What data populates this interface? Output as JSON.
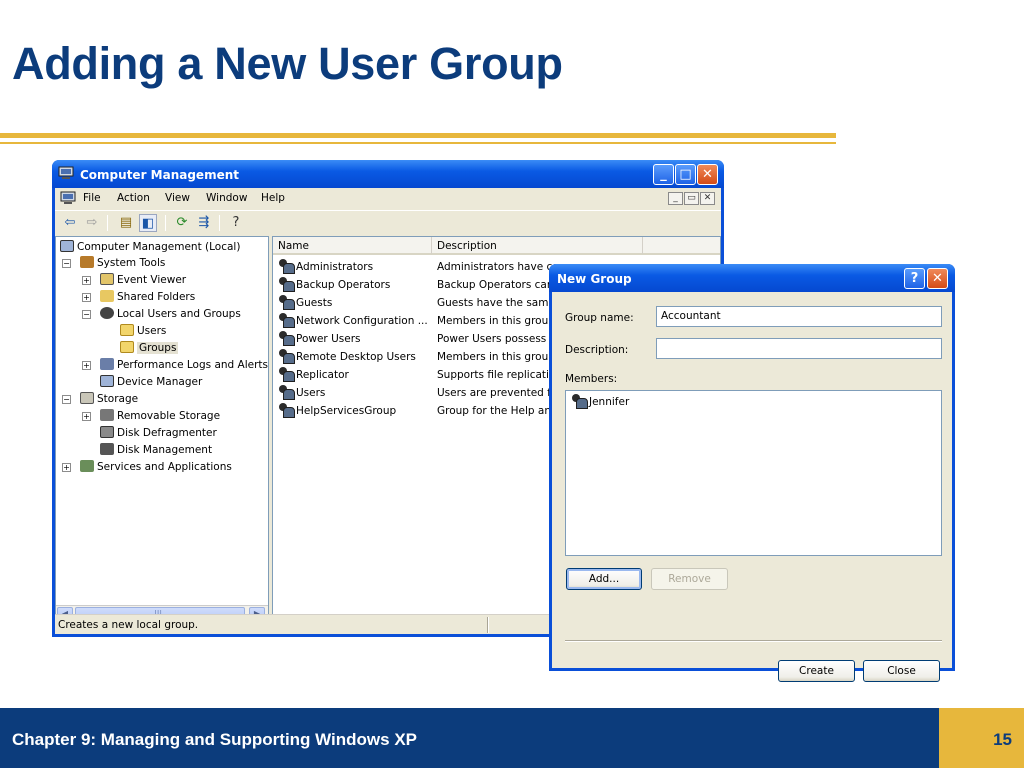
{
  "slide": {
    "title": "Adding a New User Group",
    "footer_text": "Chapter 9: Managing and Supporting Windows XP",
    "page_number": "15",
    "colors": {
      "title": "#0c3c7c",
      "accent_gold": "#e7b73c",
      "footer_bg": "#0c3c7c"
    }
  },
  "computer_management": {
    "title": "Computer Management",
    "menu": [
      "File",
      "Action",
      "View",
      "Window",
      "Help"
    ],
    "caption_buttons": {
      "minimize": "_",
      "maximize": "□",
      "close": "✕"
    },
    "mdi_buttons": [
      "_",
      "▭",
      "✕"
    ],
    "toolbar": {
      "back": "⇦",
      "forward": "⇨",
      "up": "▤",
      "show_hide": "◧",
      "refresh": "⟳",
      "export": "⇶",
      "help": "?"
    },
    "tree": [
      {
        "label": "Computer Management (Local)",
        "icon": "computer-icon"
      },
      {
        "label": "System Tools",
        "icon": "tools-icon"
      },
      {
        "label": "Event Viewer",
        "icon": "event-viewer-icon"
      },
      {
        "label": "Shared Folders",
        "icon": "shared-folder-icon"
      },
      {
        "label": "Local Users and Groups",
        "icon": "users-groups-icon"
      },
      {
        "label": "Users",
        "icon": "folder-icon"
      },
      {
        "label": "Groups",
        "icon": "folder-open-icon"
      },
      {
        "label": "Performance Logs and Alerts",
        "icon": "performance-icon"
      },
      {
        "label": "Device Manager",
        "icon": "device-manager-icon"
      },
      {
        "label": "Storage",
        "icon": "storage-icon"
      },
      {
        "label": "Removable Storage",
        "icon": "removable-storage-icon"
      },
      {
        "label": "Disk Defragmenter",
        "icon": "defrag-icon"
      },
      {
        "label": "Disk Management",
        "icon": "disk-management-icon"
      },
      {
        "label": "Services and Applications",
        "icon": "services-icon"
      }
    ],
    "tree_expanders": {
      "minus": "−",
      "plus": "+"
    },
    "scroll": {
      "left": "◀",
      "right": "▶",
      "grip": "|||"
    },
    "columns": [
      "Name",
      "Description"
    ],
    "groups": [
      {
        "name": "Administrators",
        "description": "Administrators have co"
      },
      {
        "name": "Backup Operators",
        "description": "Backup Operators can"
      },
      {
        "name": "Guests",
        "description": "Guests have the same"
      },
      {
        "name": "Network Configuration ...",
        "description": "Members in this group"
      },
      {
        "name": "Power Users",
        "description": "Power Users possess m"
      },
      {
        "name": "Remote Desktop Users",
        "description": "Members in this group"
      },
      {
        "name": "Replicator",
        "description": "Supports file replication"
      },
      {
        "name": "Users",
        "description": "Users are prevented fr"
      },
      {
        "name": "HelpServicesGroup",
        "description": "Group for the Help and"
      }
    ],
    "status": "Creates a new local group."
  },
  "new_group": {
    "title": "New Group",
    "caption_buttons": {
      "help": "?",
      "close": "✕"
    },
    "group_name_label": "Group name:",
    "group_name_value": "Accountant",
    "description_label": "Description:",
    "description_value": "",
    "members_label": "Members:",
    "members": [
      "Jennifer"
    ],
    "add_button": "Add...",
    "remove_button": "Remove",
    "create_button": "Create",
    "close_button": "Close"
  }
}
